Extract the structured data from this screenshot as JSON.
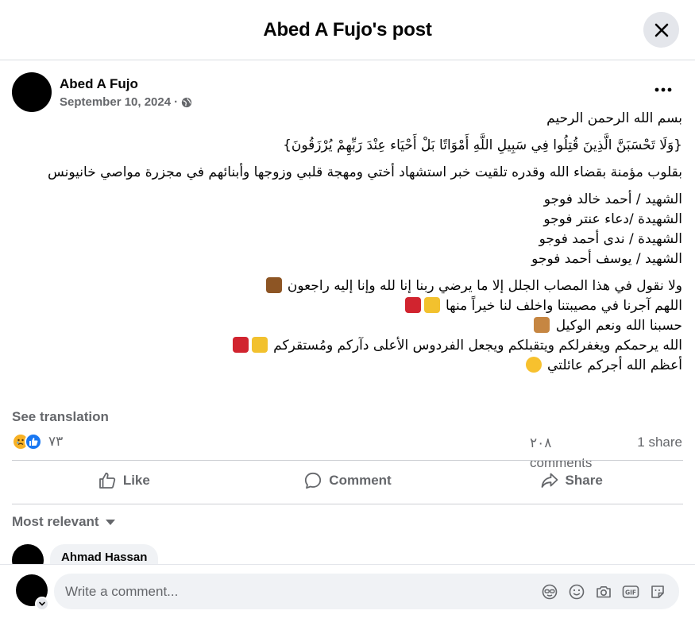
{
  "header": {
    "title": "Abed A Fujo's post"
  },
  "post": {
    "author": "Abed A Fujo",
    "date": "September 10, 2024",
    "separator": "·",
    "audience_icon": "globe-icon",
    "lines": {
      "basmala": "بسم الله الرحمن الرحيم",
      "verse": "{وَلَا تَحْسَبَنَّ الَّذِينَ قُتِلُوا فِي سَبِيلِ اللَّهِ أَمْوَاتًا بَلْ أَحْيَاء عِنْدَ رَبِّهِمْ يُرْزَقُونَ}",
      "announcement": "بقلوب مؤمنة بقضاء الله وقدره تلقيت خبر استشهاد أختي ومهجة قلبي وزوجها وأبنائهم في مجزرة مواصي خانيونس",
      "martyr_1": "الشهيد / أحمد خالد فوجو",
      "martyr_2": "الشهيدة /دعاء عنتر فوجو",
      "martyr_3": "الشهيدة / ندى أحمد فوجو",
      "martyr_4": "الشهيد / يوسف أحمد فوجو",
      "prayer_1": "ولا نقول في هذا المصاب الجلل إلا ما يرضي ربنا إنا لله وإنا إليه راجعون",
      "prayer_2": "اللهم آجرنا في مصيبتنا واخلف لنا خيراً منها",
      "prayer_3": "حسبنا الله ونعم الوكيل",
      "prayer_4": "الله يرحمكم ويغفرلكم ويتقبلكم ويجعل الفردوس الأعلى دآركم ومُستقركم",
      "prayer_5": "أعظم الله أجركم عائلتي"
    },
    "emojis": {
      "prayer_1": "index-pointing-up-medium-dark-skin",
      "prayer_2": [
        "broken-heart",
        "raising-hands"
      ],
      "prayer_3": "index-pointing-up-medium-skin",
      "prayer_4": [
        "broken-heart",
        "raising-hands"
      ],
      "prayer_5": "loudly-crying-face"
    },
    "see_translation": "See translation",
    "reaction_icons": [
      "sad-face-icon",
      "like-icon"
    ],
    "reaction_count": "٧٣",
    "comments_count": "٢٠٨ comments",
    "shares_count": "1 share"
  },
  "actions": {
    "like": "Like",
    "comment": "Comment",
    "share": "Share"
  },
  "comments": {
    "sort_label": "Most relevant",
    "first_commenter": "Ahmad Hassan"
  },
  "composer": {
    "placeholder": "Write a comment..."
  },
  "colors": {
    "secondary_text": "#65676b",
    "primary_text": "#050505",
    "like_blue": "#1877f2",
    "sad_yellow": "#f7b125",
    "input_bg": "#f0f2f5",
    "close_bg": "#e4e6eb"
  }
}
